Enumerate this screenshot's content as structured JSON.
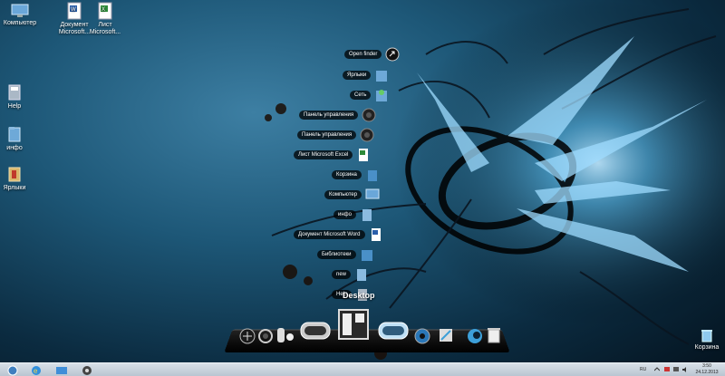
{
  "desktop": {
    "icons": [
      {
        "label": "Компьютер",
        "icon": "computer-icon"
      },
      {
        "label": "Документ Microsoft...",
        "icon": "word-document-icon"
      },
      {
        "label": "Лист Microsoft...",
        "icon": "excel-sheet-icon"
      },
      {
        "label": "Help",
        "icon": "folder-icon"
      },
      {
        "label": "инфо",
        "icon": "folder-icon"
      },
      {
        "label": "Ярлыки",
        "icon": "folder-icon"
      },
      {
        "label": "Корзина",
        "icon": "recycle-bin-icon"
      }
    ]
  },
  "stack": {
    "title": "Desktop",
    "items": [
      {
        "label": "Open finder",
        "icon": "arrow-open-icon"
      },
      {
        "label": "Ярлыки",
        "icon": "folder-icon"
      },
      {
        "label": "Сеть",
        "icon": "network-icon"
      },
      {
        "label": "Панель управления",
        "icon": "control-panel-icon"
      },
      {
        "label": "Панель управления",
        "icon": "control-panel-icon"
      },
      {
        "label": "Лист Microsoft Excel",
        "icon": "excel-sheet-icon"
      },
      {
        "label": "Корзина",
        "icon": "recycle-bin-icon"
      },
      {
        "label": "Компьютер",
        "icon": "computer-icon"
      },
      {
        "label": "инфо",
        "icon": "folder-icon"
      },
      {
        "label": "Документ Microsoft Word",
        "icon": "word-document-icon"
      },
      {
        "label": "Библиотеки",
        "icon": "libraries-icon"
      },
      {
        "label": "new",
        "icon": "folder-icon"
      },
      {
        "label": "Help",
        "icon": "folder-icon"
      }
    ]
  },
  "dock": {
    "items": [
      "finder-icon",
      "swirl-icon",
      "toggle-icon",
      "window-icon",
      "desktop-stack-icon",
      "window-rounded-icon",
      "ie-globe-icon",
      "pen-icon",
      "swirl-blue-icon",
      "trash-icon"
    ]
  },
  "taskbar": {
    "buttons": [
      "start-orb-icon",
      "internet-explorer-icon",
      "folder-icon",
      "media-icon"
    ],
    "lang": "RU",
    "time": "3:50",
    "date": "24.12.2013"
  },
  "colors": {
    "accent": "#3d9fd8",
    "taskbar": "#c8d2dc"
  }
}
